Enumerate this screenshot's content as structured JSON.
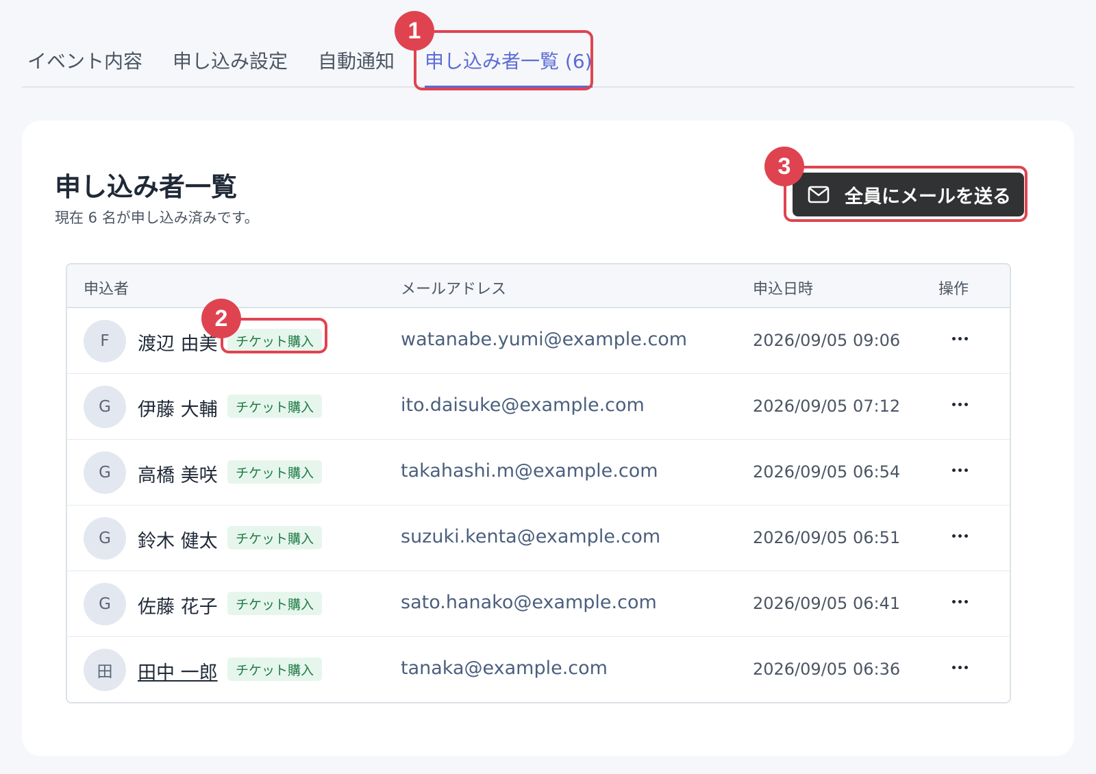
{
  "tabs": [
    {
      "label": "イベント内容",
      "active": false
    },
    {
      "label": "申し込み設定",
      "active": false
    },
    {
      "label": "自動通知",
      "active": false
    },
    {
      "label": "申し込み者一覧 (6)",
      "active": true
    }
  ],
  "callouts": [
    "1",
    "2",
    "3"
  ],
  "card": {
    "title": "申し込み者一覧",
    "subtitle": "現在 6 名が申し込み済みです。",
    "mail_button_label": "全員にメールを送る",
    "mail_icon": "envelope-icon"
  },
  "table": {
    "headers": {
      "applicant": "申込者",
      "email": "メールアドレス",
      "date": "申込日時",
      "actions": "操作"
    },
    "rows": [
      {
        "initial": "F",
        "name": "渡辺 由美",
        "tag": "チケット購入",
        "email": "watanabe.yumi@example.com",
        "date": "2026/09/05 09:06"
      },
      {
        "initial": "G",
        "name": "伊藤 大輔",
        "tag": "チケット購入",
        "email": "ito.daisuke@example.com",
        "date": "2026/09/05 07:12"
      },
      {
        "initial": "G",
        "name": "高橋 美咲",
        "tag": "チケット購入",
        "email": "takahashi.m@example.com",
        "date": "2026/09/05 06:54"
      },
      {
        "initial": "G",
        "name": "鈴木 健太",
        "tag": "チケット購入",
        "email": "suzuki.kenta@example.com",
        "date": "2026/09/05 06:51"
      },
      {
        "initial": "G",
        "name": "佐藤 花子",
        "tag": "チケット購入",
        "email": "sato.hanako@example.com",
        "date": "2026/09/05 06:41"
      },
      {
        "initial": "田",
        "name": "田中 一郎",
        "tag": "チケット購入",
        "email": "tanaka@example.com",
        "date": "2026/09/05 06:36"
      }
    ]
  },
  "colors": {
    "accent": "#5b6bd5",
    "callout": "#e04350",
    "button_bg": "#303233",
    "tag_bg": "#e6f6ec",
    "tag_text": "#1f7a47"
  }
}
